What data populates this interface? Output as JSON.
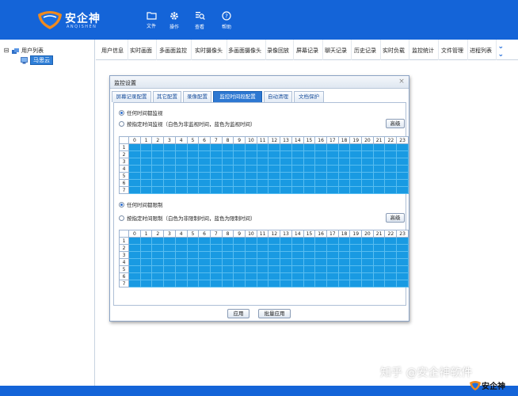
{
  "app": {
    "name": "安企神",
    "subtitle": "ANQISHEN"
  },
  "header": {
    "buttons": [
      {
        "label": "文件",
        "icon": "folder-icon"
      },
      {
        "label": "操作",
        "icon": "gear-icon"
      },
      {
        "label": "查看",
        "icon": "view-search-icon"
      },
      {
        "label": "帮助",
        "icon": "help-icon"
      }
    ]
  },
  "tree": {
    "root_label": "用户列表",
    "root_toggle": "⊟",
    "child_label": "马思云"
  },
  "top_tabs": [
    "用户信息",
    "实时画面",
    "多画面监控",
    "实时摄像头",
    "多画面摄像头",
    "录像回放",
    "屏幕记录",
    "聊天记录",
    "历史记录",
    "实时负载",
    "监控统计",
    "文件管理",
    "进程列表"
  ],
  "dialog": {
    "title": "监控设置",
    "close": "×",
    "tabs": [
      "屏幕记录配置",
      "其它配置",
      "录像配置",
      "监控时间段配置",
      "自动清理",
      "文档保护"
    ],
    "active_tab": 3,
    "section1": {
      "radio1": "任何时间都监视",
      "radio2": "按指定时间监视（白色为非监视时间，蓝色为监视时间）",
      "advanced": "高级"
    },
    "section2": {
      "radio1": "任何时间都限制",
      "radio2": "按指定时间限制（白色为非限制时间，蓝色为限制时间）",
      "advanced": "高级"
    },
    "hours": [
      "0",
      "1",
      "2",
      "3",
      "4",
      "5",
      "6",
      "7",
      "8",
      "9",
      "10",
      "11",
      "12",
      "13",
      "14",
      "15",
      "16",
      "17",
      "18",
      "19",
      "20",
      "21",
      "22",
      "23"
    ],
    "days": [
      "1",
      "2",
      "3",
      "4",
      "5",
      "6",
      "7"
    ],
    "apply": "应用",
    "batch_apply": "批量应用"
  },
  "watermark": {
    "text": "知乎 @安企神软件",
    "corner_text": "安企神"
  },
  "colors": {
    "header_blue": "#1464d8",
    "cell_blue": "#199ae2",
    "tab_active": "#2d78d2"
  }
}
